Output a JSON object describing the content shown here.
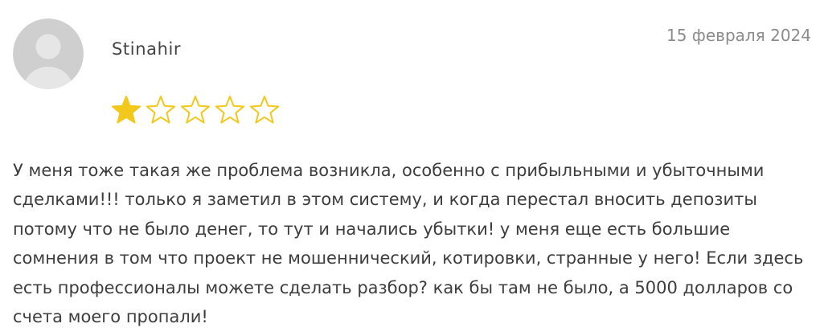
{
  "review": {
    "author": "Stinahir",
    "date": "15 февраля 2024",
    "rating": 1,
    "max_rating": 5,
    "text": "У меня тоже такая же проблема возникла, особенно с прибыльными и убыточными сделками!!! только я заметил в этом систему, и когда перестал вносить депозиты потому что не было денег, то тут и начались убытки! у меня еще есть большие сомнения в том что проект не мошеннический, котировки, странные у него! Если здесь есть профессионалы можете сделать разбор? как бы там не было, а 5000 долларов со счета моего пропали!"
  },
  "colors": {
    "star": "#f2c81a",
    "avatar_bg": "#cfcfcf",
    "avatar_figure": "#e6e6e6"
  },
  "icons": {
    "avatar": "default-user-avatar-icon",
    "rating": "star-icon"
  }
}
